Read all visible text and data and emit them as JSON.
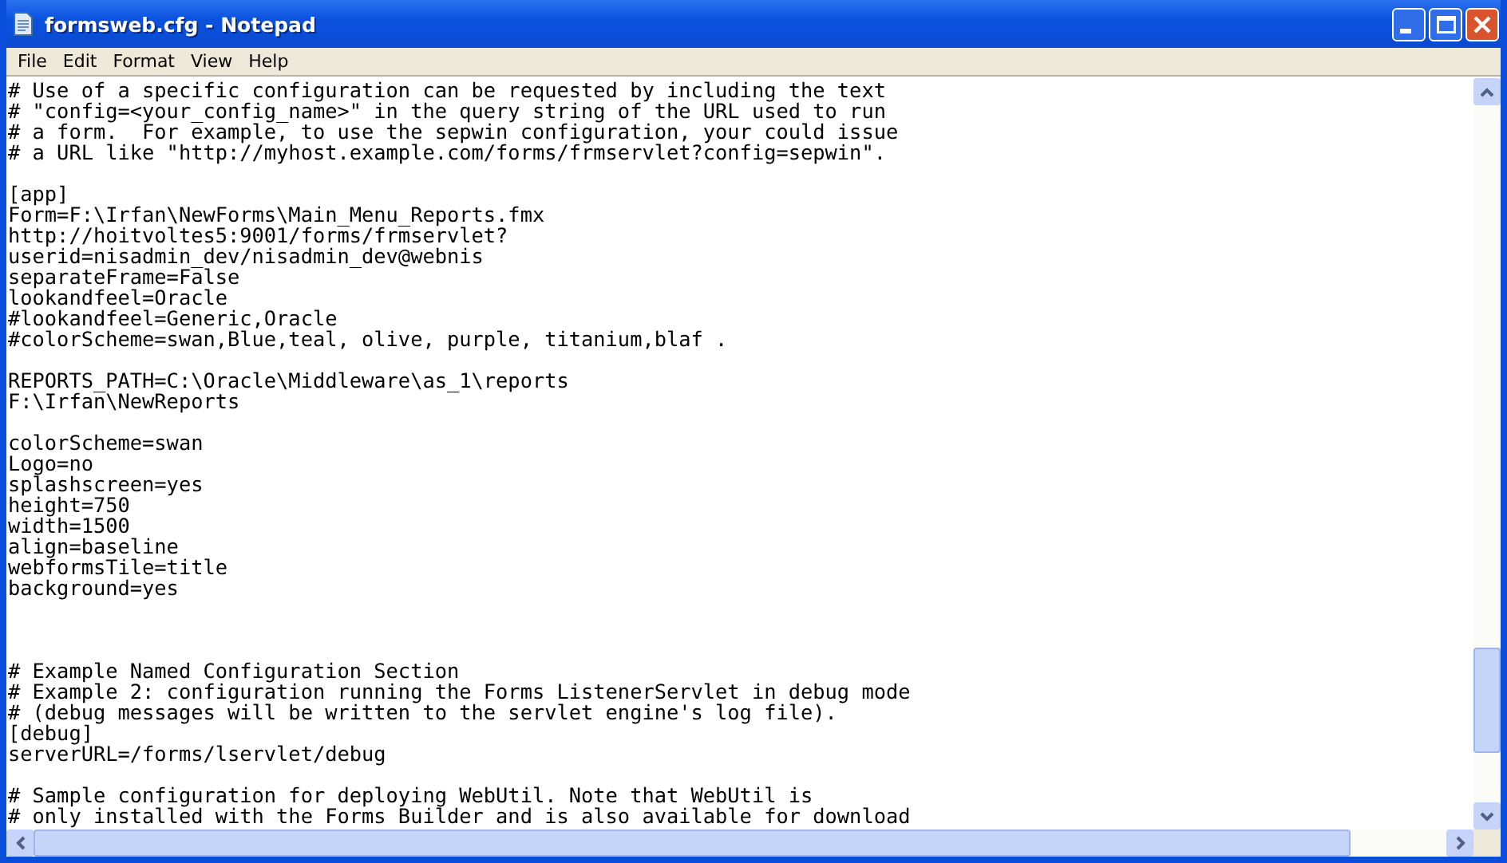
{
  "window": {
    "title": "formsweb.cfg - Notepad"
  },
  "menu": [
    {
      "label": "File"
    },
    {
      "label": "Edit"
    },
    {
      "label": "Format"
    },
    {
      "label": "View"
    },
    {
      "label": "Help"
    }
  ],
  "editor": {
    "lines": [
      {
        "kind": "text",
        "text": "# Use of a specific configuration can be requested by including the text"
      },
      {
        "kind": "text",
        "text": "# \"config=<your_config_name>\" in the query string of the URL used to run"
      },
      {
        "kind": "text",
        "text": "# a form.  For example, to use the sepwin configuration, your could issue"
      },
      {
        "kind": "text",
        "text": "# a URL like \"http://myhost.example.com/forms/frmservlet?config=sepwin\"."
      },
      {
        "kind": "blank"
      },
      {
        "kind": "text",
        "text": "[app]"
      },
      {
        "kind": "text",
        "text": "Form=F:\\Irfan\\NewForms\\Main_Menu_Reports.fmx"
      },
      {
        "kind": "text",
        "text": "http://hoitvoltes5:9001/forms/frmservlet?"
      },
      {
        "kind": "text",
        "text": "userid=nisadmin_dev/nisadmin_dev@webnis"
      },
      {
        "kind": "text",
        "text": "separateFrame=False"
      },
      {
        "kind": "text",
        "text": "lookandfeel=Oracle"
      },
      {
        "kind": "text",
        "text": "#lookandfeel=Generic,Oracle"
      },
      {
        "kind": "text",
        "text": "#colorScheme=swan,Blue,teal, olive, purple, titanium,blaf ."
      },
      {
        "kind": "blank"
      },
      {
        "kind": "text",
        "text": "REPORTS_PATH=C:\\Oracle\\Middleware\\as_1\\reports"
      },
      {
        "kind": "text",
        "text": "F:\\Irfan\\NewReports"
      },
      {
        "kind": "blank"
      },
      {
        "kind": "text",
        "text": "colorScheme=swan"
      },
      {
        "kind": "text",
        "text": "Logo=no"
      },
      {
        "kind": "text",
        "text": "splashscreen=yes"
      },
      {
        "kind": "text",
        "text": "height=750"
      },
      {
        "kind": "text",
        "text": "width=1500"
      },
      {
        "kind": "text",
        "text": "align=baseline"
      },
      {
        "kind": "text",
        "text": "webformsTile=title"
      },
      {
        "kind": "text",
        "text": "background=yes"
      },
      {
        "kind": "blank"
      },
      {
        "kind": "blank"
      },
      {
        "kind": "blank"
      },
      {
        "kind": "text",
        "text": "# Example Named Configuration Section"
      },
      {
        "kind": "text",
        "text": "# Example 2: configuration running the Forms ListenerServlet in debug mode"
      },
      {
        "kind": "text",
        "text": "# (debug messages will be written to the servlet engine's log file)."
      },
      {
        "kind": "text",
        "text": "[debug]"
      },
      {
        "kind": "text",
        "text": "serverURL=/forms/lservlet/debug"
      },
      {
        "kind": "blank"
      },
      {
        "kind": "text",
        "text": "# Sample configuration for deploying WebUtil. Note that WebUtil is"
      },
      {
        "kind": "text",
        "text": "# only installed with the Forms Builder and is also available for download"
      }
    ]
  }
}
